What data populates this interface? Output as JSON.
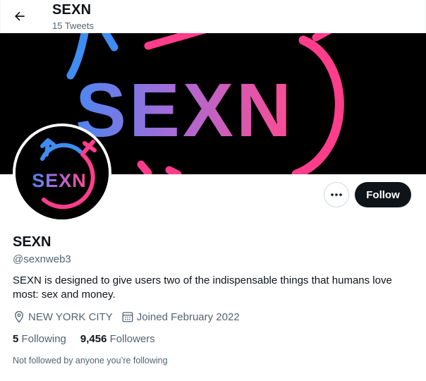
{
  "header": {
    "title": "SEXN",
    "tweet_count": "15 Tweets",
    "back_icon": "arrow-left-icon"
  },
  "banner": {
    "text": "SEXN",
    "colors": {
      "background": "#000000",
      "blue": "#3f8cf2",
      "pink": "#ff3d8b",
      "purple": "#b765d8"
    }
  },
  "avatar": {
    "text": "SEXN"
  },
  "actions": {
    "more_icon": "more-dots-icon",
    "follow_label": "Follow"
  },
  "profile": {
    "name": "SEXN",
    "handle": "@sexnweb3",
    "bio": "SEXN is designed to give users two of the indispensable things that humans love most: sex and money.",
    "location": "NEW YORK CITY",
    "joined": "Joined February 2022",
    "following_count": "5",
    "following_label": "Following",
    "followers_count": "9,456",
    "followers_label": "Followers",
    "not_followed_text": "Not followed by anyone you’re following"
  }
}
